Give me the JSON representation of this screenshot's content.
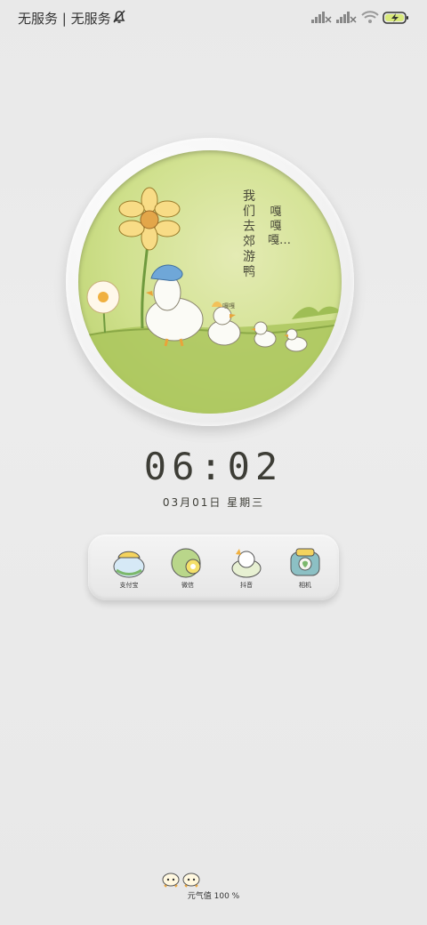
{
  "status_bar": {
    "carrier_text": "无服务 | 无服务"
  },
  "widget": {
    "poem_line1": "我们去郊游鸭",
    "poem_line2": "嘎嘎嘎…",
    "duck_say": "嘎嘎"
  },
  "clock": {
    "time": "06:02",
    "date": "03月01日 星期三"
  },
  "dock": {
    "apps": [
      {
        "label": "支付宝"
      },
      {
        "label": "微信"
      },
      {
        "label": "抖音"
      },
      {
        "label": "相机"
      }
    ]
  },
  "footer": {
    "energy": "元气值 100 %"
  },
  "colors": {
    "accent_green": "#c9dd86",
    "duck_white": "#fbfbf6",
    "hat_blue": "#6fa7d8"
  }
}
